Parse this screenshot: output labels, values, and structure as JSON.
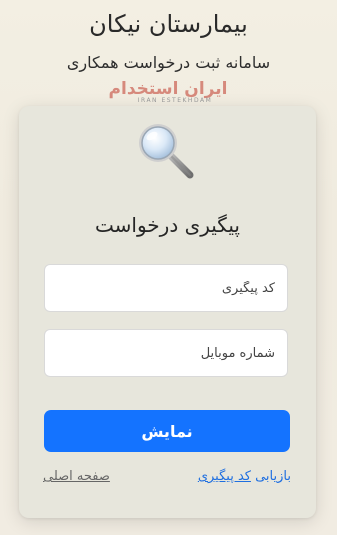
{
  "header": {
    "title": "بیمارستان نیکان",
    "subtitle": "سامانه ثبت درخواست همکاری"
  },
  "watermark": {
    "brand_fa": "ایران استخدام",
    "brand_en": "IRAN ESTEKHDAM",
    "color": "#c0392b"
  },
  "card": {
    "icon": "magnifier-icon",
    "title": "پیگیری درخواست",
    "tracking_code": {
      "placeholder": "کد پیگیری",
      "value": ""
    },
    "mobile": {
      "placeholder": "شماره موبایل",
      "value": ""
    },
    "submit_label": "نمایش",
    "recover_link": {
      "prefix": "بازیابی ",
      "underlined": "کد پیگیری"
    },
    "home_link": "صفحه اصلی"
  },
  "colors": {
    "accent": "#1473ff",
    "link": "#1f6fe0",
    "muted_link": "#666666",
    "card_bg": "#e7e6dc"
  }
}
